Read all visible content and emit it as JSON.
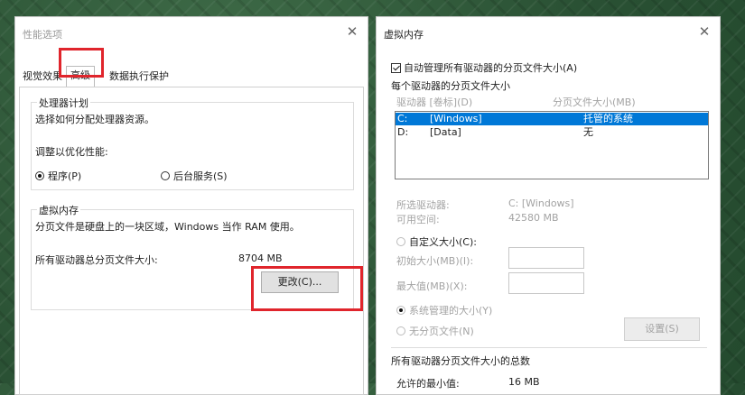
{
  "perf": {
    "title": "性能选项",
    "tabs": [
      "视觉效果",
      "高级",
      "数据执行保护"
    ],
    "processor": {
      "title": "处理器计划",
      "desc": "选择如何分配处理器资源。",
      "adjust": "调整以优化性能:",
      "opt_programs": "程序(P)",
      "opt_background": "后台服务(S)"
    },
    "virtual_memory": {
      "title": "虚拟内存",
      "desc": "分页文件是硬盘上的一块区域，Windows 当作 RAM 使用。",
      "total_label": "所有驱动器总分页文件大小:",
      "total_value": "8704 MB",
      "change_button": "更改(C)..."
    }
  },
  "vm": {
    "title": "虚拟内存",
    "auto_manage": "自动管理所有驱动器的分页文件大小(A)",
    "per_drive_title": "每个驱动器的分页文件大小",
    "col_drive": "驱动器 [卷标](D)",
    "col_size": "分页文件大小(MB)",
    "drives": [
      {
        "drive": "C:",
        "label": "[Windows]",
        "size": "托管的系统"
      },
      {
        "drive": "D:",
        "label": "[Data]",
        "size": "无"
      }
    ],
    "selected_drive_label": "所选驱动器:",
    "selected_drive_value": "C:  [Windows]",
    "free_space_label": "可用空间:",
    "free_space_value": "42580 MB",
    "custom_size": "自定义大小(C):",
    "initial_size": "初始大小(MB)(I):",
    "max_size": "最大值(MB)(X):",
    "system_managed": "系统管理的大小(Y)",
    "no_paging": "无分页文件(N)",
    "set_button": "设置(S)",
    "total_title": "所有驱动器分页文件大小的总数",
    "min_allowed_label": "允许的最小值:",
    "min_allowed_value": "16 MB"
  },
  "icons": {
    "close": "close-icon"
  },
  "colors": {
    "selection": "#0078d7",
    "highlight_box": "#e0252c"
  }
}
